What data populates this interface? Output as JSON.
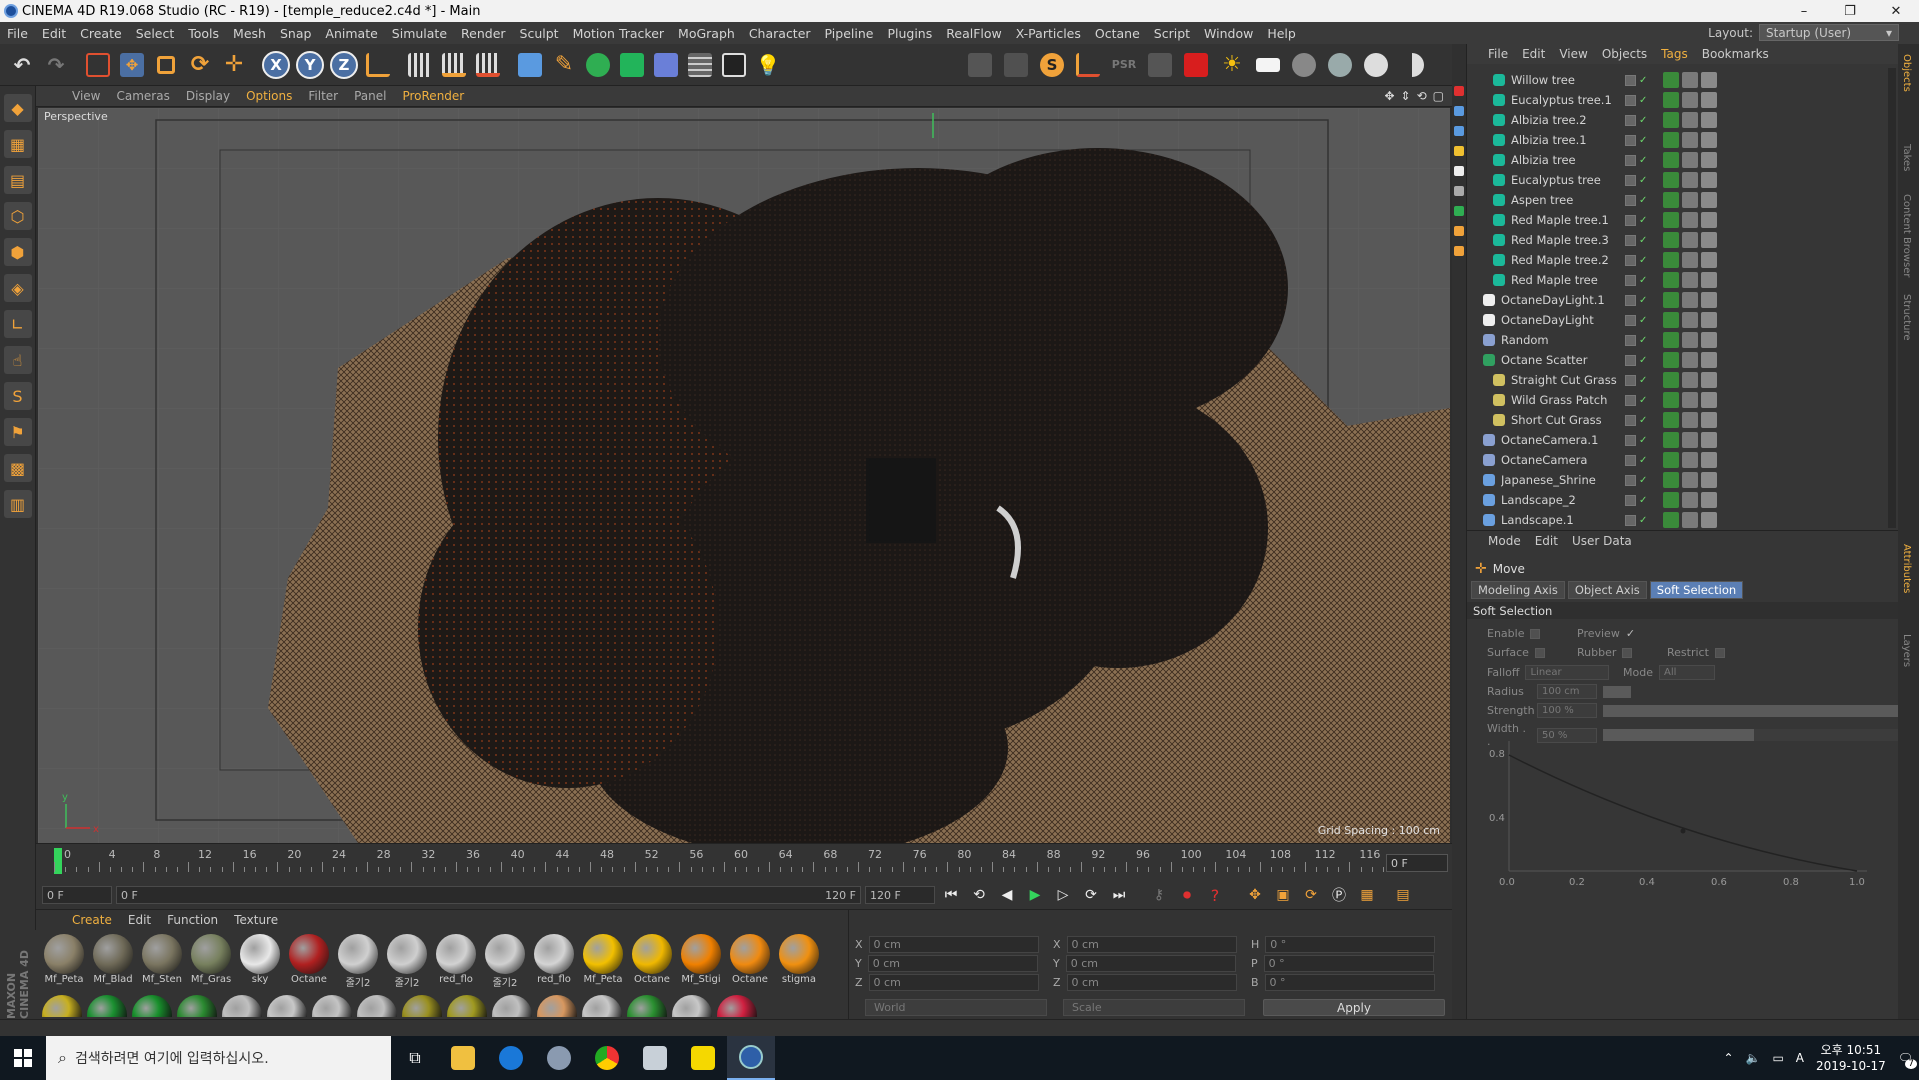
{
  "window": {
    "title": "CINEMA 4D R19.068 Studio (RC - R19) - [temple_reduce2.c4d *] - Main",
    "min": "–",
    "max": "❐",
    "close": "✕"
  },
  "menubar": {
    "items": [
      "File",
      "Edit",
      "Create",
      "Select",
      "Tools",
      "Mesh",
      "Snap",
      "Animate",
      "Simulate",
      "Render",
      "Sculpt",
      "Motion Tracker",
      "MoGraph",
      "Character",
      "Pipeline",
      "Plugins",
      "RealFlow",
      "X-Particles",
      "Octane",
      "Script",
      "Window",
      "Help"
    ],
    "layout_label": "Layout:",
    "layout_value": "Startup (User)"
  },
  "toolbar": {
    "x": "X",
    "y": "Y",
    "z": "Z"
  },
  "viewport": {
    "menu": [
      "View",
      "Cameras",
      "Display",
      "Options",
      "Filter",
      "Panel",
      "ProRender"
    ],
    "label": "Perspective",
    "grid_spacing": "Grid Spacing : 100 cm",
    "axis_y": "y",
    "axis_x": "x"
  },
  "timeline": {
    "ticks": [
      "0",
      "4",
      "8",
      "12",
      "16",
      "20",
      "24",
      "28",
      "32",
      "36",
      "40",
      "44",
      "48",
      "52",
      "56",
      "60",
      "64",
      "68",
      "72",
      "76",
      "80",
      "84",
      "88",
      "92",
      "96",
      "100",
      "104",
      "108",
      "112",
      "116"
    ],
    "current": "0 F"
  },
  "transport": {
    "start": "0 F",
    "range_start": "0 F",
    "range_end": "120 F",
    "end": "120 F"
  },
  "materials": {
    "menu": [
      "Create",
      "Edit",
      "Function",
      "Texture"
    ],
    "items": [
      {
        "name": "Mf_Peta",
        "color": "#8a8068"
      },
      {
        "name": "Mf_Blad",
        "color": "#6f6a58"
      },
      {
        "name": "Mf_Sten",
        "color": "#7a7560"
      },
      {
        "name": "Mf_Gras",
        "color": "#77805e"
      },
      {
        "name": "sky",
        "color": "#e8e8e8"
      },
      {
        "name": "Octane",
        "color": "#b02020"
      },
      {
        "name": "줄기2",
        "color": "#d0d0d0"
      },
      {
        "name": "줄기2",
        "color": "#cfcfcf"
      },
      {
        "name": "red_flo",
        "color": "#d2d2d2"
      },
      {
        "name": "줄기2",
        "color": "#d0d0d0"
      },
      {
        "name": "red_flo",
        "color": "#d4d4d4"
      },
      {
        "name": "Mf_Peta",
        "color": "#f2c000"
      },
      {
        "name": "Octane",
        "color": "#f0b800"
      },
      {
        "name": "Mf_Stigi",
        "color": "#f08000"
      },
      {
        "name": "Octane",
        "color": "#f08a10"
      },
      {
        "name": "stigma",
        "color": "#f09010"
      }
    ],
    "row2": [
      "#c8b020",
      "#1a9030",
      "#18902c",
      "#2a8a30",
      "#c0c0c0",
      "#c8c8c8",
      "#c4c4c4",
      "#c0c0c0",
      "#9a9020",
      "#a09a20",
      "#c0c0c0",
      "#d89860",
      "#c8c8c8",
      "#2a9030",
      "#c8c8c8",
      "#d02040"
    ]
  },
  "coords": {
    "x_pos": "0 cm",
    "y_pos": "0 cm",
    "z_pos": "0 cm",
    "x_size": "0 cm",
    "y_size": "0 cm",
    "z_size": "0 cm",
    "h": "0 °",
    "p": "0 °",
    "b": "0 °",
    "world": "World",
    "scale": "Scale",
    "apply": "Apply",
    "labels": {
      "x": "X",
      "y": "Y",
      "z": "Z",
      "h": "H",
      "p": "P",
      "b": "B"
    }
  },
  "objmgr": {
    "menu": [
      "File",
      "Edit",
      "View",
      "Objects",
      "Tags",
      "Bookmarks"
    ],
    "objects": [
      {
        "name": "Willow tree",
        "icon": "#1bb99a",
        "indent": 2
      },
      {
        "name": "Eucalyptus tree.1",
        "icon": "#1bb99a",
        "indent": 2
      },
      {
        "name": "Albizia tree.2",
        "icon": "#1bb99a",
        "indent": 2
      },
      {
        "name": "Albizia tree.1",
        "icon": "#1bb99a",
        "indent": 2
      },
      {
        "name": "Albizia tree",
        "icon": "#1bb99a",
        "indent": 2
      },
      {
        "name": "Eucalyptus tree",
        "icon": "#1bb99a",
        "indent": 2
      },
      {
        "name": "Aspen tree",
        "icon": "#1bb99a",
        "indent": 2
      },
      {
        "name": "Red Maple tree.1",
        "icon": "#1bb99a",
        "indent": 2
      },
      {
        "name": "Red Maple tree.3",
        "icon": "#1bb99a",
        "indent": 2
      },
      {
        "name": "Red Maple tree.2",
        "icon": "#1bb99a",
        "indent": 2
      },
      {
        "name": "Red Maple tree",
        "icon": "#1bb99a",
        "indent": 2
      },
      {
        "name": "OctaneDayLight.1",
        "icon": "#eeeeee",
        "indent": 1
      },
      {
        "name": "OctaneDayLight",
        "icon": "#eeeeee",
        "indent": 1
      },
      {
        "name": "Random",
        "icon": "#8aa0d0",
        "indent": 1
      },
      {
        "name": "Octane Scatter",
        "icon": "#30a060",
        "indent": 1
      },
      {
        "name": "Straight Cut Grass",
        "icon": "#d0c060",
        "indent": 2
      },
      {
        "name": "Wild Grass Patch",
        "icon": "#d0c060",
        "indent": 2
      },
      {
        "name": "Short Cut Grass",
        "icon": "#d0c060",
        "indent": 2
      },
      {
        "name": "OctaneCamera.1",
        "icon": "#8aa0d0",
        "indent": 1
      },
      {
        "name": "OctaneCamera",
        "icon": "#8aa0d0",
        "indent": 1
      },
      {
        "name": "Japanese_Shrine",
        "icon": "#6aa0e0",
        "indent": 1
      },
      {
        "name": "Landscape_2",
        "icon": "#6aa0e0",
        "indent": 1
      },
      {
        "name": "Landscape.1",
        "icon": "#6aa0e0",
        "indent": 1
      }
    ]
  },
  "attr": {
    "menu": [
      "Mode",
      "Edit",
      "User Data"
    ],
    "tool": "Move",
    "tabs": [
      "Modeling Axis",
      "Object Axis",
      "Soft Selection"
    ],
    "section": "Soft Selection",
    "enable": "Enable",
    "preview": "Preview",
    "surface": "Surface",
    "rubber": "Rubber",
    "restrict": "Restrict",
    "falloff": "Falloff",
    "falloff_value": "Linear",
    "mode": "Mode",
    "mode_value": "All",
    "radius": "Radius",
    "radius_value": "100 cm",
    "strength": "Strength",
    "strength_value": "100 %",
    "strength_level": 1.0,
    "width": "Width . .",
    "width_value": "50 %",
    "width_level": 0.5,
    "graph_y": [
      "0.8",
      "0.4"
    ],
    "graph_x": [
      "0.0",
      "0.2",
      "0.4",
      "0.6",
      "0.8",
      "1.0"
    ]
  },
  "sidetabs": [
    "Objects",
    "Takes",
    "Content Browser",
    "Structure",
    "Attributes",
    "Layers"
  ],
  "taskbar": {
    "search_placeholder": "검색하려면 여기에 입력하십시오.",
    "time": "오후 10:51",
    "date": "2019-10-17",
    "ime": "A",
    "notify": "7"
  }
}
